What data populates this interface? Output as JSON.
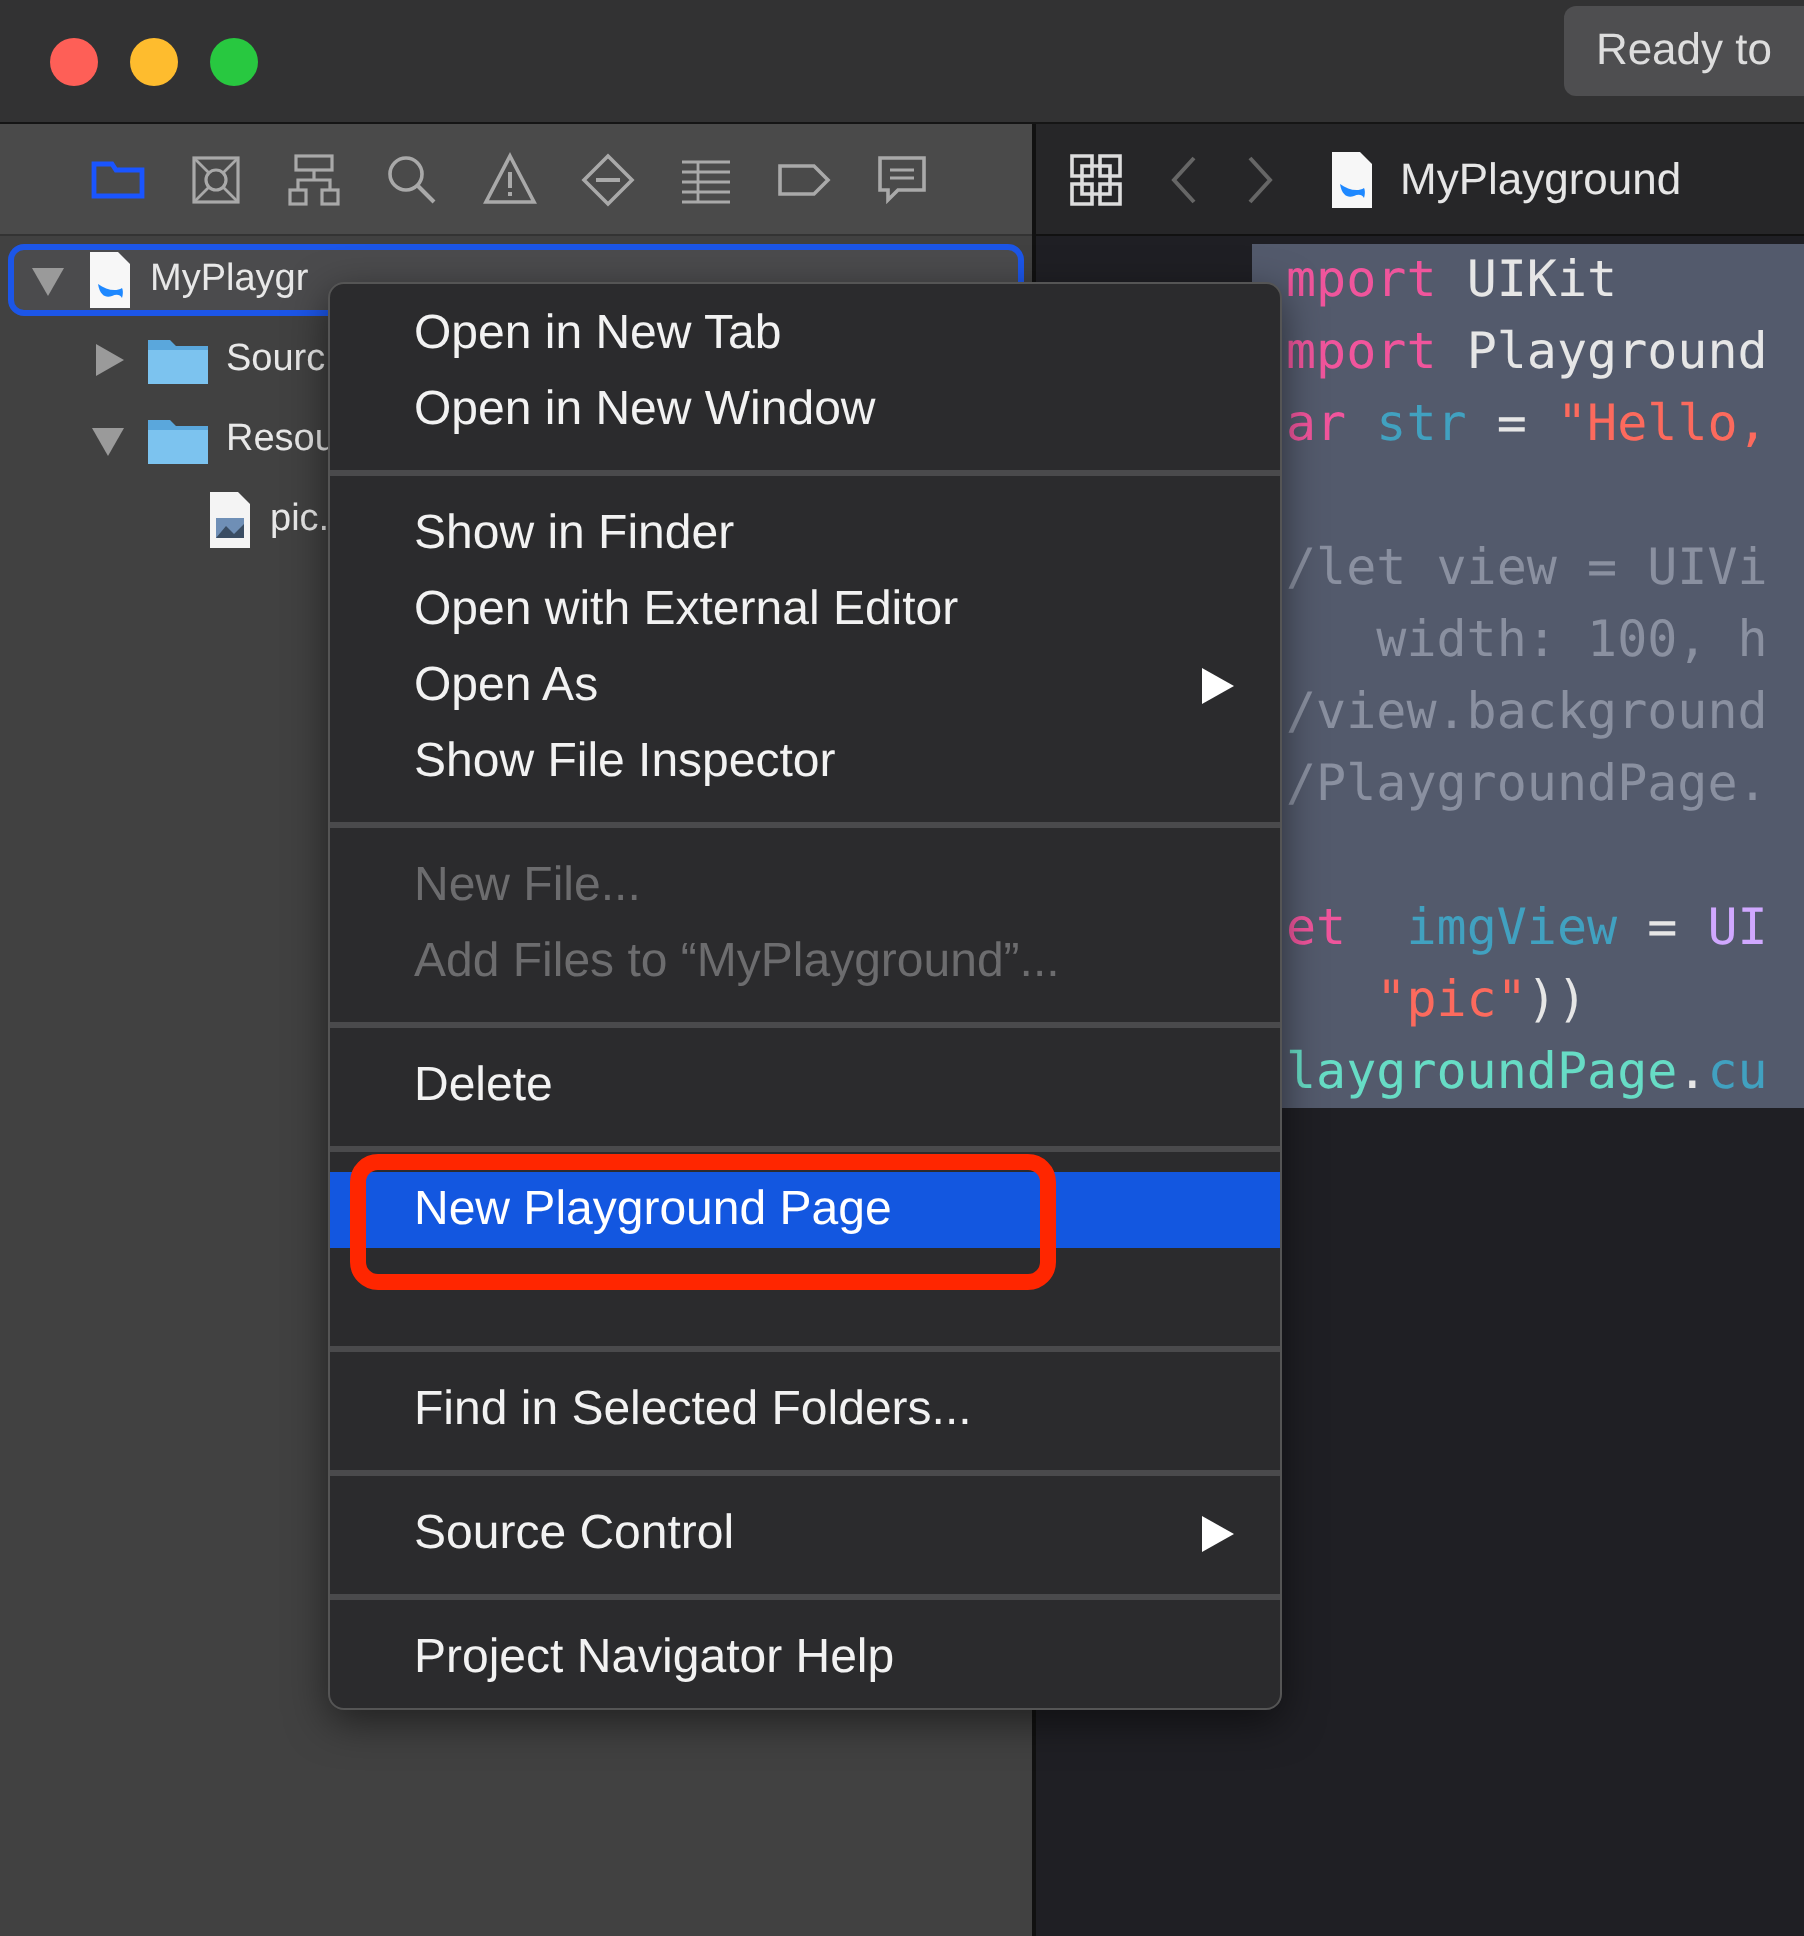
{
  "window": {
    "status": "Ready to"
  },
  "navigator_toolbar": {
    "tabs": [
      {
        "kind": "folder",
        "selected": true
      },
      {
        "kind": "box",
        "selected": false
      },
      {
        "kind": "hierarchy",
        "selected": false
      },
      {
        "kind": "search",
        "selected": false
      },
      {
        "kind": "warning",
        "selected": false
      },
      {
        "kind": "diamond",
        "selected": false
      },
      {
        "kind": "list",
        "selected": false
      },
      {
        "kind": "tag",
        "selected": false
      },
      {
        "kind": "comment",
        "selected": false
      }
    ]
  },
  "tree": [
    {
      "label": "MyPlaygr",
      "kind": "playground",
      "expanded": true,
      "selected": true,
      "children": [
        {
          "label": "Sourc",
          "kind": "folder",
          "expanded": false,
          "selected": false
        },
        {
          "label": "Resou",
          "kind": "folder",
          "expanded": true,
          "selected": false,
          "children": [
            {
              "label": "pic.",
              "kind": "image",
              "selected": false
            }
          ]
        }
      ]
    }
  ],
  "editor": {
    "breadcrumb": "MyPlayground",
    "blocks": [
      [
        [
          {
            "kind": "keyword",
            "text": "mport"
          },
          {
            "kind": "plain",
            "text": " UIKit"
          }
        ],
        [
          {
            "kind": "keyword",
            "text": "mport"
          },
          {
            "kind": "plain",
            "text": " Playground"
          }
        ],
        [
          {
            "kind": "keyword",
            "text": "ar"
          },
          {
            "kind": "ident",
            "text": " str"
          },
          {
            "kind": "plain",
            "text": " = "
          },
          {
            "kind": "string",
            "text": "\"Hello,"
          }
        ]
      ],
      [
        [
          {
            "kind": "comment",
            "text": "/let view = UIVi"
          }
        ],
        [
          {
            "kind": "comment",
            "text": "   width: 100, h"
          }
        ],
        [
          {
            "kind": "comment",
            "text": "/view.background"
          }
        ],
        [
          {
            "kind": "comment",
            "text": "/PlaygroundPage."
          }
        ]
      ],
      [
        [
          {
            "kind": "keyword",
            "text": "et"
          },
          {
            "kind": "ident",
            "text": "  imgView"
          },
          {
            "kind": "plain",
            "text": " = "
          },
          {
            "kind": "type",
            "text": "UI"
          }
        ],
        [
          {
            "kind": "string",
            "text": "   \"pic\""
          },
          {
            "kind": "plain",
            "text": "))"
          }
        ],
        [
          {
            "kind": "member",
            "text": "laygroundPage"
          },
          {
            "kind": "plain",
            "text": "."
          },
          {
            "kind": "ident",
            "text": "cu"
          }
        ]
      ]
    ]
  },
  "context_menu": {
    "groups": [
      [
        {
          "label": "Open in New Tab",
          "disabled": false,
          "selected": false,
          "submenu": false
        },
        {
          "label": "Open in New Window",
          "disabled": false,
          "selected": false,
          "submenu": false
        }
      ],
      [
        {
          "label": "Show in Finder",
          "disabled": false,
          "selected": false,
          "submenu": false
        },
        {
          "label": "Open with External Editor",
          "disabled": false,
          "selected": false,
          "submenu": false
        },
        {
          "label": "Open As",
          "disabled": false,
          "selected": false,
          "submenu": true
        },
        {
          "label": "Show File Inspector",
          "disabled": false,
          "selected": false,
          "submenu": false
        }
      ],
      [
        {
          "label": "New File...",
          "disabled": true,
          "selected": false,
          "submenu": false
        },
        {
          "label": "Add Files to “MyPlayground”...",
          "disabled": true,
          "selected": false,
          "submenu": false
        }
      ],
      [
        {
          "label": "Delete",
          "disabled": false,
          "selected": false,
          "submenu": false
        }
      ],
      [
        {
          "label": "New Playground Page",
          "disabled": false,
          "selected": true,
          "submenu": false
        },
        {
          "kind": "obscured"
        }
      ],
      [
        {
          "label": "Find in Selected Folders...",
          "disabled": false,
          "selected": false,
          "submenu": false
        }
      ],
      [
        {
          "label": "Source Control",
          "disabled": false,
          "selected": false,
          "submenu": true
        }
      ],
      [
        {
          "label": "Project Navigator Help",
          "disabled": false,
          "selected": false,
          "submenu": false
        }
      ]
    ]
  }
}
